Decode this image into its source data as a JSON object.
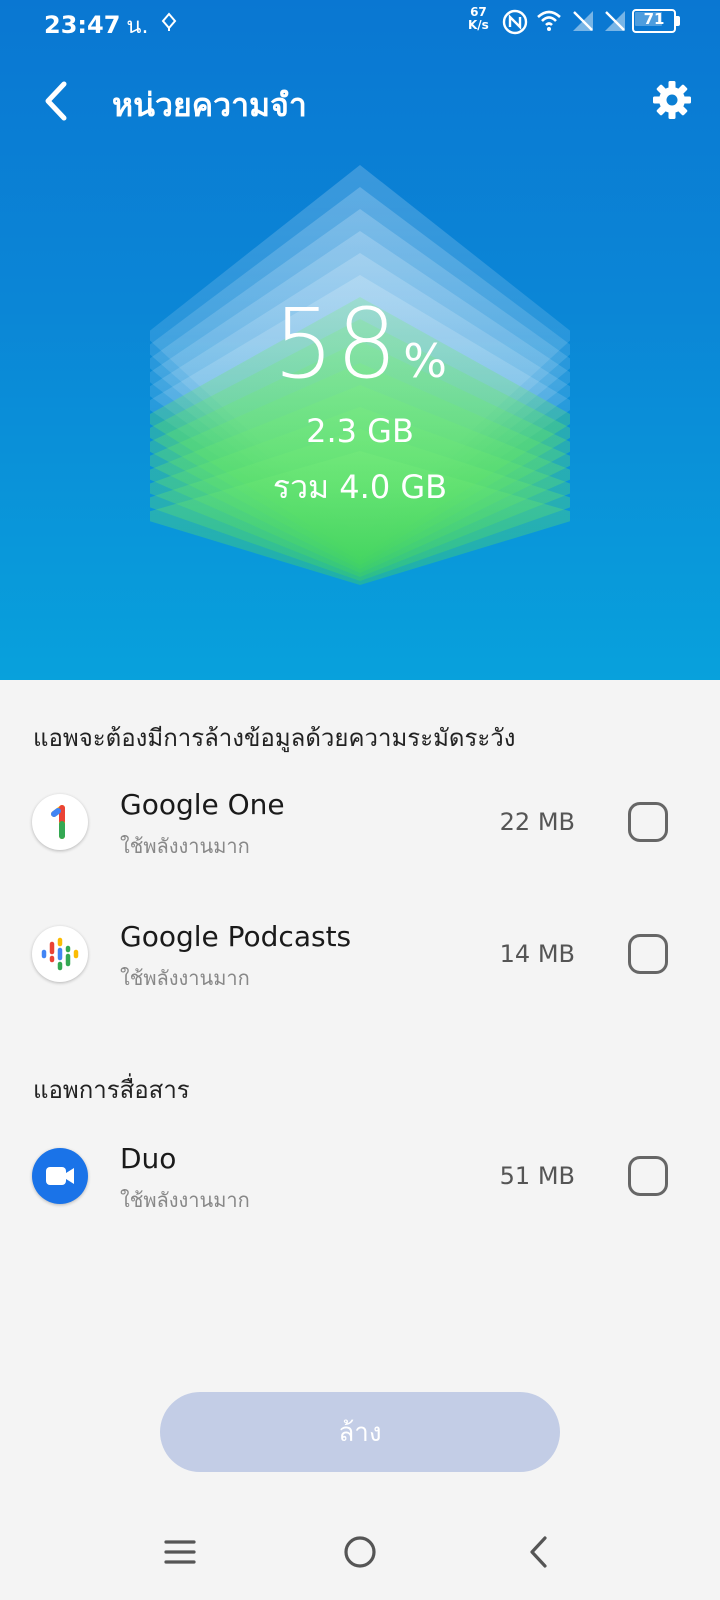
{
  "status_bar": {
    "time": "23:47",
    "time_suffix": "น.",
    "net_speed_value": "67",
    "net_speed_unit": "K/s",
    "battery_level": "71",
    "battery_fraction": 0.71
  },
  "header": {
    "title": "หน่วยความจำ",
    "back_icon": "chevron-left-icon",
    "settings_icon": "gear-icon"
  },
  "memory": {
    "percent": "58",
    "percent_sign": "%",
    "used": "2.3 GB",
    "total": "รวม 4.0 GB",
    "used_fraction": 0.58
  },
  "sections": [
    {
      "title": "แอพจะต้องมีการล้างข้อมูลด้วยความระมัดระวัง",
      "apps": [
        {
          "name": "Google One",
          "subtitle": "ใช้พลังงานมาก",
          "size": "22 MB",
          "icon": "google-one-icon",
          "checked": false
        },
        {
          "name": "Google Podcasts",
          "subtitle": "ใช้พลังงานมาก",
          "size": "14 MB",
          "icon": "google-podcasts-icon",
          "checked": false
        }
      ]
    },
    {
      "title": "แอพการสื่อสาร",
      "apps": [
        {
          "name": "Duo",
          "subtitle": "ใช้พลังงานมาก",
          "size": "51 MB",
          "icon": "duo-icon",
          "checked": false
        }
      ]
    }
  ],
  "clear_button": {
    "label": "ล้าง",
    "enabled": false
  },
  "navbar": {
    "menu_icon": "menu-icon",
    "home_icon": "home-icon",
    "back_icon": "back-icon"
  },
  "colors": {
    "hero_top": "#0a77d2",
    "hero_bottom": "#08a1dc",
    "gauge_green": "#5be35a",
    "button_disabled": "#c3cde6",
    "duo_blue": "#1a73e8"
  }
}
